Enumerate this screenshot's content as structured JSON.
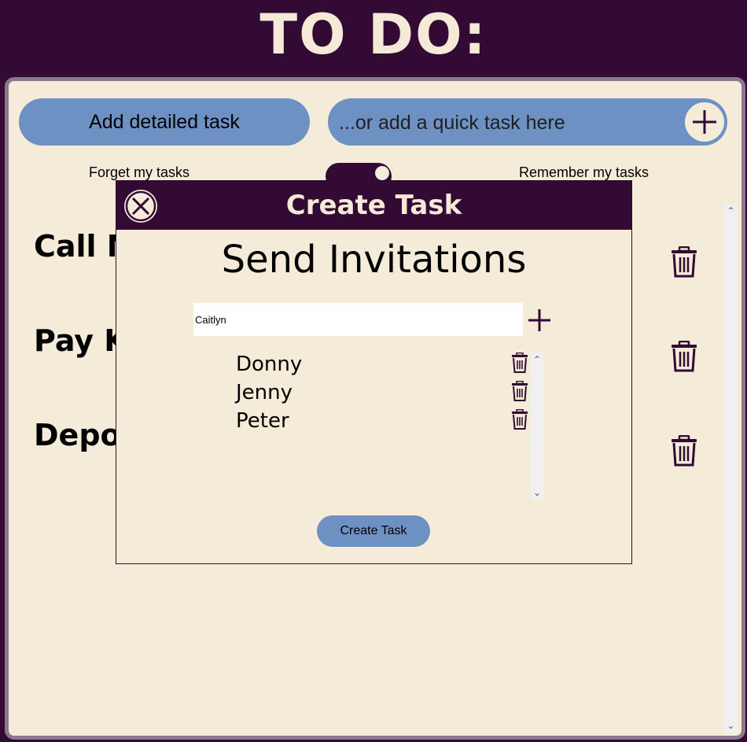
{
  "app": {
    "title": "TO DO:"
  },
  "toolbar": {
    "detailed_label": "Add detailed task",
    "quick_placeholder": "...or add a quick task here",
    "quick_add_icon": "plus-icon"
  },
  "toggle": {
    "left_label": "Forget my tasks",
    "right_label": "Remember my tasks",
    "state": "remember"
  },
  "tasks": [
    {
      "title": "Call M",
      "delete_icon": "trash-icon"
    },
    {
      "title": "Pay Ki",
      "delete_icon": "trash-icon"
    },
    {
      "title": "Depos",
      "delete_icon": "trash-icon"
    }
  ],
  "modal": {
    "title": "Create Task",
    "close_icon": "close-circle-icon",
    "section_heading": "Send Invitations",
    "invite_input_value": "Caitlyn",
    "invite_add_icon": "plus-icon",
    "invitees": [
      "Donny",
      "Jenny",
      "Peter"
    ],
    "create_button": "Create Task"
  },
  "colors": {
    "background": "#320a33",
    "panel": "#f5ebd9",
    "button": "#6e91c3",
    "title": "#f5ead8"
  }
}
